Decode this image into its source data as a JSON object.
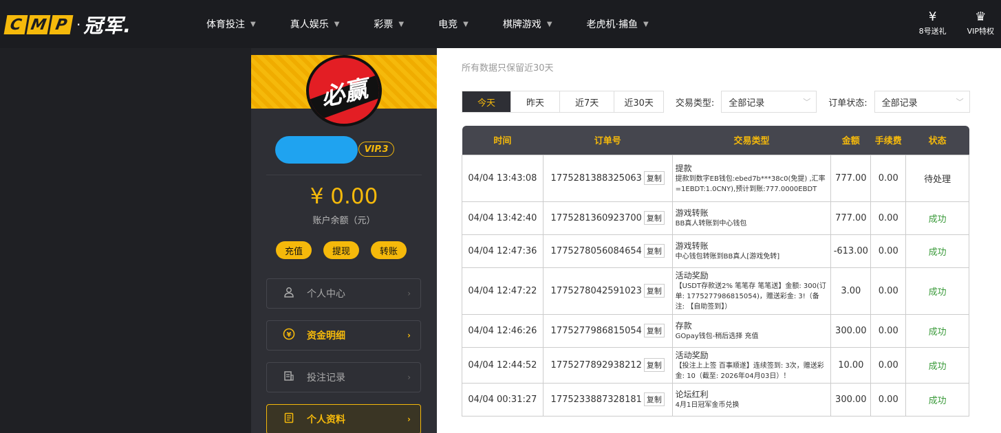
{
  "brand": {
    "logo_letters": [
      "C",
      "M",
      "P"
    ],
    "logo_dot": "·",
    "logo_name": "冠军."
  },
  "nav": [
    {
      "label": "体育投注"
    },
    {
      "label": "真人娱乐"
    },
    {
      "label": "彩票"
    },
    {
      "label": "电竞"
    },
    {
      "label": "棋牌游戏"
    },
    {
      "label": "老虎机·捕鱼"
    }
  ],
  "top_right": [
    {
      "label": "8号送礼",
      "icon": "gift-icon"
    },
    {
      "label": "VIP特权",
      "icon": "crown-icon"
    }
  ],
  "profile": {
    "avatar_text": "必赢",
    "vip": "VIP.3",
    "balance": "¥ 0.00",
    "balance_label": "账户余额（元）",
    "actions": [
      "充值",
      "提现",
      "转账"
    ]
  },
  "menu": [
    {
      "label": "个人中心",
      "icon": "user-icon",
      "active": false
    },
    {
      "label": "资金明细",
      "icon": "yen-circle-icon",
      "active": true
    },
    {
      "label": "投注记录",
      "icon": "bet-record-icon",
      "active": false
    },
    {
      "label": "个人资料",
      "icon": "profile-doc-icon",
      "active": true
    }
  ],
  "content": {
    "notice": "所有数据只保留近30天",
    "date_tabs": [
      "今天",
      "昨天",
      "近7天",
      "近30天"
    ],
    "type_label": "交易类型:",
    "type_value": "全部记录",
    "status_label": "订单状态:",
    "status_value": "全部记录",
    "copy_label": "复制",
    "columns": [
      "时间",
      "订单号",
      "交易类型",
      "金额",
      "手续费",
      "状态"
    ],
    "rows": [
      {
        "time": "04/04 13:43:08",
        "order": "1775281388325063",
        "type": "提款",
        "detail": "提款到数字EB钱包:ebed7b***38c0(免提) ,汇率=1EBDT:1.0CNY),预计到账:777.0000EBDT",
        "amount": "777.00",
        "fee": "0.00",
        "status": "待处理"
      },
      {
        "time": "04/04 13:42:40",
        "order": "1775281360923700",
        "type": "游戏转账",
        "detail": "BB真人转账到中心钱包",
        "amount": "777.00",
        "fee": "0.00",
        "status": "成功"
      },
      {
        "time": "04/04 12:47:36",
        "order": "1775278056084654",
        "type": "游戏转账",
        "detail": "中心钱包转账到BB真人[游戏免转]",
        "amount": "-613.00",
        "fee": "0.00",
        "status": "成功"
      },
      {
        "time": "04/04 12:47:22",
        "order": "1775278042591023",
        "type": "活动奖励",
        "detail": "【USDT存款送2% 笔笔存 笔笔送】金额: 300(订单: 1775277986815054)，赠送彩金: 3!（备注: 【自助签到】）",
        "amount": "3.00",
        "fee": "0.00",
        "status": "成功"
      },
      {
        "time": "04/04 12:46:26",
        "order": "1775277986815054",
        "type": "存款",
        "detail": "GOpay钱包-稍后选择 充值",
        "amount": "300.00",
        "fee": "0.00",
        "status": "成功"
      },
      {
        "time": "04/04 12:44:52",
        "order": "1775277892938212",
        "type": "活动奖励",
        "detail": "【投注上上签 百事顺遂】连续签到: 3次，赠送彩金: 10（截至: 2026年04月03日）！",
        "amount": "10.00",
        "fee": "0.00",
        "status": "成功"
      },
      {
        "time": "04/04 00:31:27",
        "order": "1775233887328181",
        "type": "论坛红利",
        "detail": "4月1日冠军金币兑换",
        "amount": "300.00",
        "fee": "0.00",
        "status": "成功"
      }
    ]
  },
  "colors": {
    "accent": "#f5b90b",
    "dark": "#2e2f35",
    "success": "#3a9a3a"
  }
}
